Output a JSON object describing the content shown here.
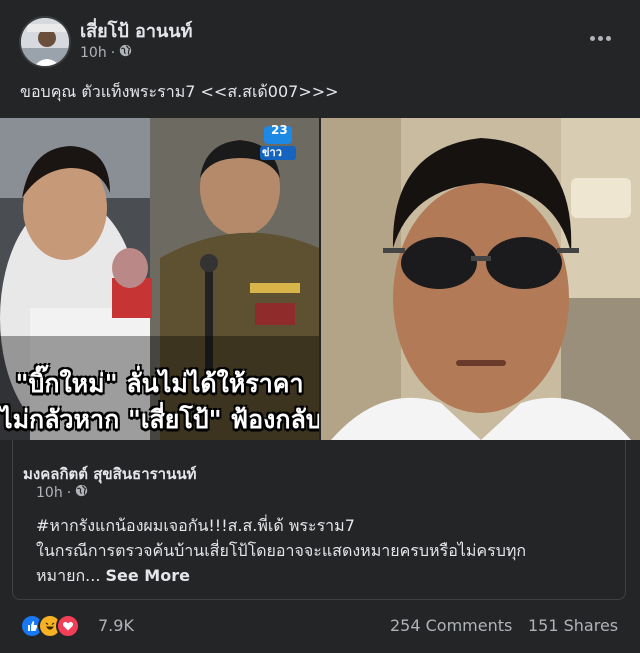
{
  "post": {
    "author": "เสี่ยโป้ อานนท์",
    "time": "10h",
    "privacy_icon": "globe-icon",
    "caption": "ขอบคุณ ตัวแท็งพระราม7 <<ส.สเด้007>>>",
    "more_icon": "more-dots-icon"
  },
  "images": {
    "left": {
      "headline_line1": "\"บิ๊กใหม่\" ลั่นไม่ได้ให้ราคา",
      "headline_line2": "ไม่กลัวหาก \"เสี่ยโป้\" ฟ้องกลับ",
      "channel_number": "23",
      "channel_name": "ข่าว"
    }
  },
  "shared": {
    "author": "มงคลกิตต์ สุขสินธารานนท์",
    "time": "10h",
    "line1": "#หากรังแกน้องผมเจอกัน!!!ส.ส.พี่เด้ พระราม7",
    "line2": "ในกรณีการตรวจค้นบ้านเสี่ยโป้โดยอาจจะแสดงหมายครบหรือไม่ครบทุก",
    "line3": "หมายก...",
    "see_more": "See More"
  },
  "footer": {
    "reactions_count": "7.9K",
    "comments": "254 Comments",
    "shares": "151 Shares",
    "colors": {
      "like": "#1877f2",
      "haha": "#f7b125",
      "love": "#f33e58"
    }
  }
}
